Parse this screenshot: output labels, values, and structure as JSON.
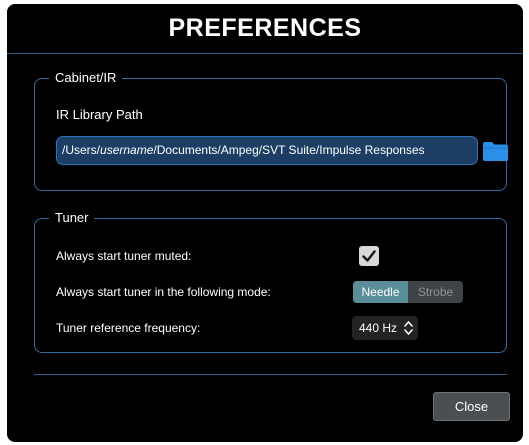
{
  "dialog": {
    "title": "PREFERENCES"
  },
  "cabinet": {
    "legend": "Cabinet/IR",
    "path_label": "IR Library Path",
    "path_prefix": "/Users/",
    "path_user": "username",
    "path_suffix": "/Documents/Ampeg/SVT Suite/Impulse Responses",
    "folder_icon": "folder-icon"
  },
  "tuner": {
    "legend": "Tuner",
    "muted_label": "Always start tuner muted:",
    "muted_checked": true,
    "mode_label": "Always start tuner in the following mode:",
    "mode_options": [
      "Needle",
      "Strobe"
    ],
    "mode_selected": "Needle",
    "freq_label": "Tuner reference frequency:",
    "freq_value": "440 Hz"
  },
  "footer": {
    "close_label": "Close"
  },
  "colors": {
    "background": "#000000",
    "accent_border": "#2f6ca3",
    "field_fill": "#1c3e64",
    "toggle_active": "#5a8e9a",
    "folder_blue": "#2a8fe8"
  }
}
